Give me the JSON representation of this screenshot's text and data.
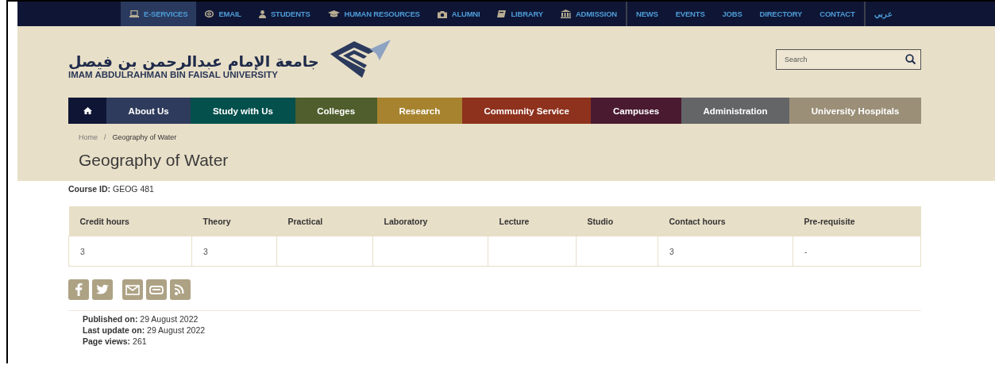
{
  "top_bar": {
    "groups": [
      [
        {
          "label": "E-SERVICES",
          "selected": true
        },
        {
          "label": "EMAIL",
          "selected": false
        },
        {
          "label": "STUDENTS",
          "selected": false
        },
        {
          "label": "HUMAN RESOURCES",
          "selected": false
        },
        {
          "label": "ALUMNI",
          "selected": false
        },
        {
          "label": "LIBRARY",
          "selected": false
        },
        {
          "label": "ADMISSION",
          "selected": false
        }
      ],
      [
        {
          "label": "NEWS",
          "selected": false
        },
        {
          "label": "EVENTS",
          "selected": false
        },
        {
          "label": "JOBS",
          "selected": false
        },
        {
          "label": "DIRECTORY",
          "selected": false
        },
        {
          "label": "CONTACT",
          "selected": false
        }
      ],
      [
        {
          "label": "عربي",
          "selected": false
        }
      ]
    ]
  },
  "logo": {
    "arabic_name": "جامعة الإمام عبدالرحمن بن فيصل",
    "english_name": "IMAM ABDULRAHMAN BIN FAISAL UNIVERSITY"
  },
  "search": {
    "placeholder": "Search"
  },
  "main_nav": [
    {
      "kind": "home",
      "color": "#0f1635"
    },
    {
      "label": "About Us",
      "color": "#2e3b5c"
    },
    {
      "label": "Study with Us",
      "color": "#03504c"
    },
    {
      "label": "Colleges",
      "color": "#4f5e2c"
    },
    {
      "label": "Research",
      "color": "#a7832f"
    },
    {
      "label": "Community Service",
      "color": "#8e321d"
    },
    {
      "label": "Campuses",
      "color": "#4a1a31"
    },
    {
      "label": "Administration",
      "color": "#646567"
    },
    {
      "label": "University Hospitals",
      "color": "#9b8f78"
    }
  ],
  "breadcrumb": {
    "items": [
      "Home",
      "Geography of Water"
    ],
    "separator": "/"
  },
  "page_title": "Geography of Water",
  "course_id": "**Course ID:** GEOG 481",
  "table": {
    "columns": [
      "Credit hours",
      "Theory",
      "Practical",
      "Laboratory",
      "Lecture",
      "Studio",
      "Contact hours",
      "Pre-requisite"
    ],
    "rows": [
      [
        "3",
        "3",
        "",
        "",
        "",
        "",
        "3",
        "-"
      ]
    ]
  },
  "share_buttons": [
    {
      "kind": "facebook"
    },
    {
      "kind": "twitter"
    },
    {
      "kind": "email"
    },
    {
      "kind": "print"
    },
    {
      "kind": "rss"
    }
  ],
  "meta": [
    "**Published on:** 29 August 2022",
    "**Last update on:** 29 August 2022",
    "**Page views:** 261"
  ]
}
